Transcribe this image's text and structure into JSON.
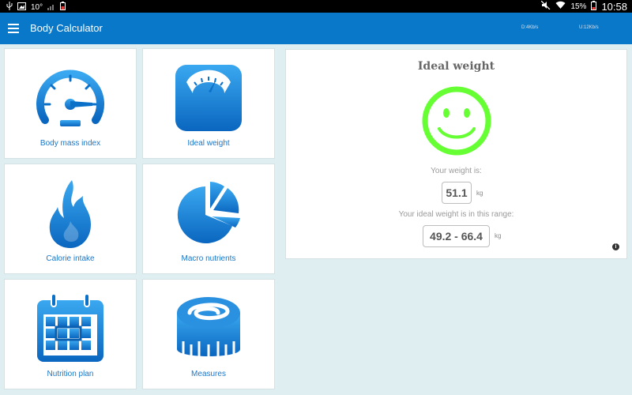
{
  "status_bar": {
    "left_temp": "10°",
    "battery_pct": "15%",
    "time": "10:58",
    "net_down": "D:4Kb/s",
    "net_up": "U:12Kb/s"
  },
  "app_bar": {
    "title": "Body Calculator"
  },
  "tiles": [
    {
      "label": "Body mass index",
      "icon": "speedometer-icon"
    },
    {
      "label": "Ideal weight",
      "icon": "scale-icon"
    },
    {
      "label": "Calorie intake",
      "icon": "flame-icon"
    },
    {
      "label": "Macro nutrients",
      "icon": "pie-chart-icon"
    },
    {
      "label": "Nutrition plan",
      "icon": "calendar-icon"
    },
    {
      "label": "Measures",
      "icon": "measuring-tape-icon"
    }
  ],
  "result": {
    "title": "Ideal weight",
    "your_weight_label": "Your weight is:",
    "your_weight_value": "51.1",
    "your_weight_unit": "kg",
    "range_label": "Your ideal weight is in this range:",
    "range_value": "49.2 - 66.4",
    "range_unit": "kg"
  },
  "colors": {
    "accent": "#0a78c8",
    "tile_label": "#1976c8",
    "smiley": "#66ff33",
    "background": "#dfeef0"
  }
}
